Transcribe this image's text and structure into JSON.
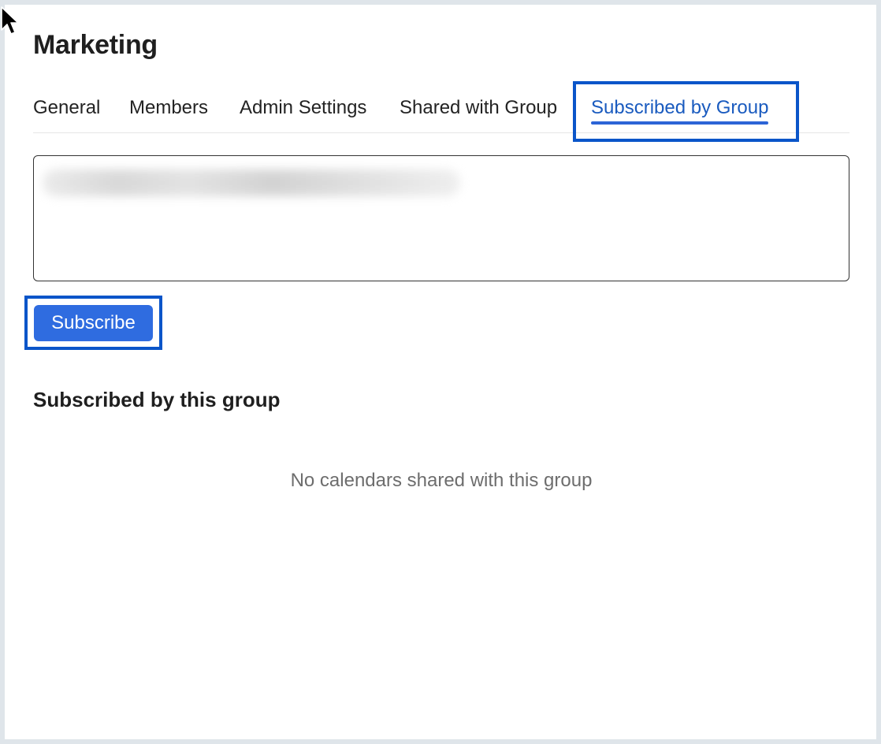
{
  "page": {
    "title": "Marketing"
  },
  "tabs": [
    {
      "label": "General",
      "active": false
    },
    {
      "label": "Members",
      "active": false
    },
    {
      "label": "Admin Settings",
      "active": false
    },
    {
      "label": "Shared with Group",
      "active": false
    },
    {
      "label": "Subscribed by Group",
      "active": true
    }
  ],
  "subscribe": {
    "input_value": "",
    "button_label": "Subscribe"
  },
  "subscribed_section": {
    "title": "Subscribed by this group",
    "empty_message": "No calendars shared with this group"
  },
  "colors": {
    "accent": "#2f6ce0",
    "active_tab_text": "#1a5bbf",
    "highlight": "#0a55c9"
  },
  "icons": {
    "cursor": "mouse-pointer-icon"
  }
}
